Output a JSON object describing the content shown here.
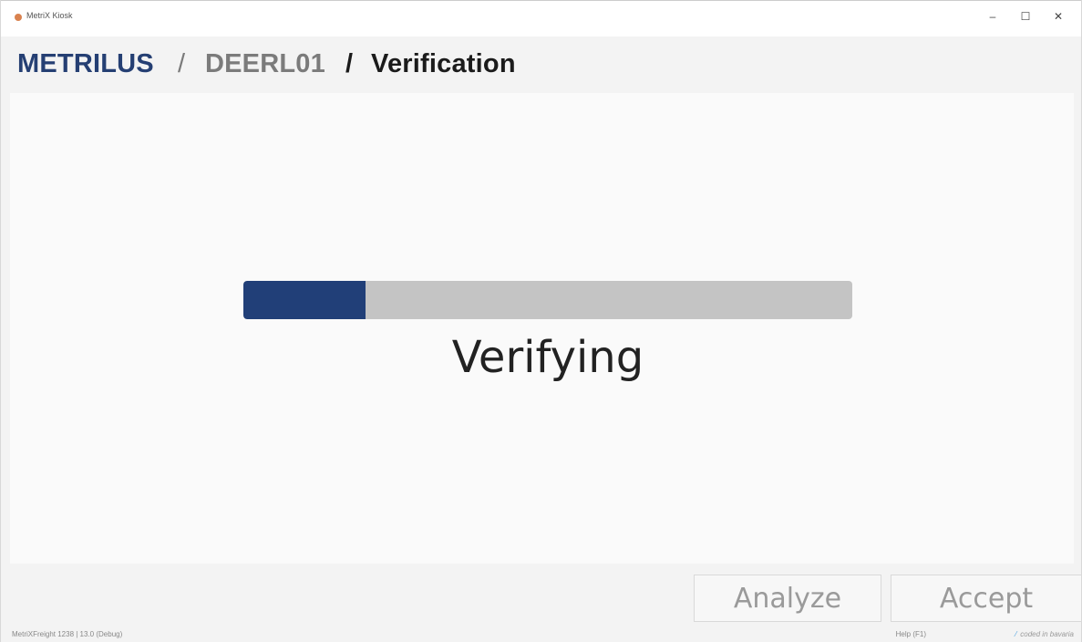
{
  "window": {
    "title": "MetriX Kiosk",
    "controls": {
      "minimize": "–",
      "maximize": "☐",
      "close": "✕"
    }
  },
  "breadcrumb": {
    "root": "METRILUS",
    "separator": "/",
    "device": "DEERL01",
    "page": "Verification"
  },
  "progress": {
    "value_fraction": 0.2,
    "fill_color": "#213f78",
    "track_color": "#c4c4c4",
    "status_text": "Verifying"
  },
  "actions": {
    "analyze_label": "Analyze",
    "accept_label": "Accept"
  },
  "statusbar": {
    "version": "MetriXFreight 1238 | 13.0 (Debug)",
    "help": "Help (F1)",
    "coded_in": "coded in bavaria",
    "leaf_icon": "leaf-icon"
  }
}
